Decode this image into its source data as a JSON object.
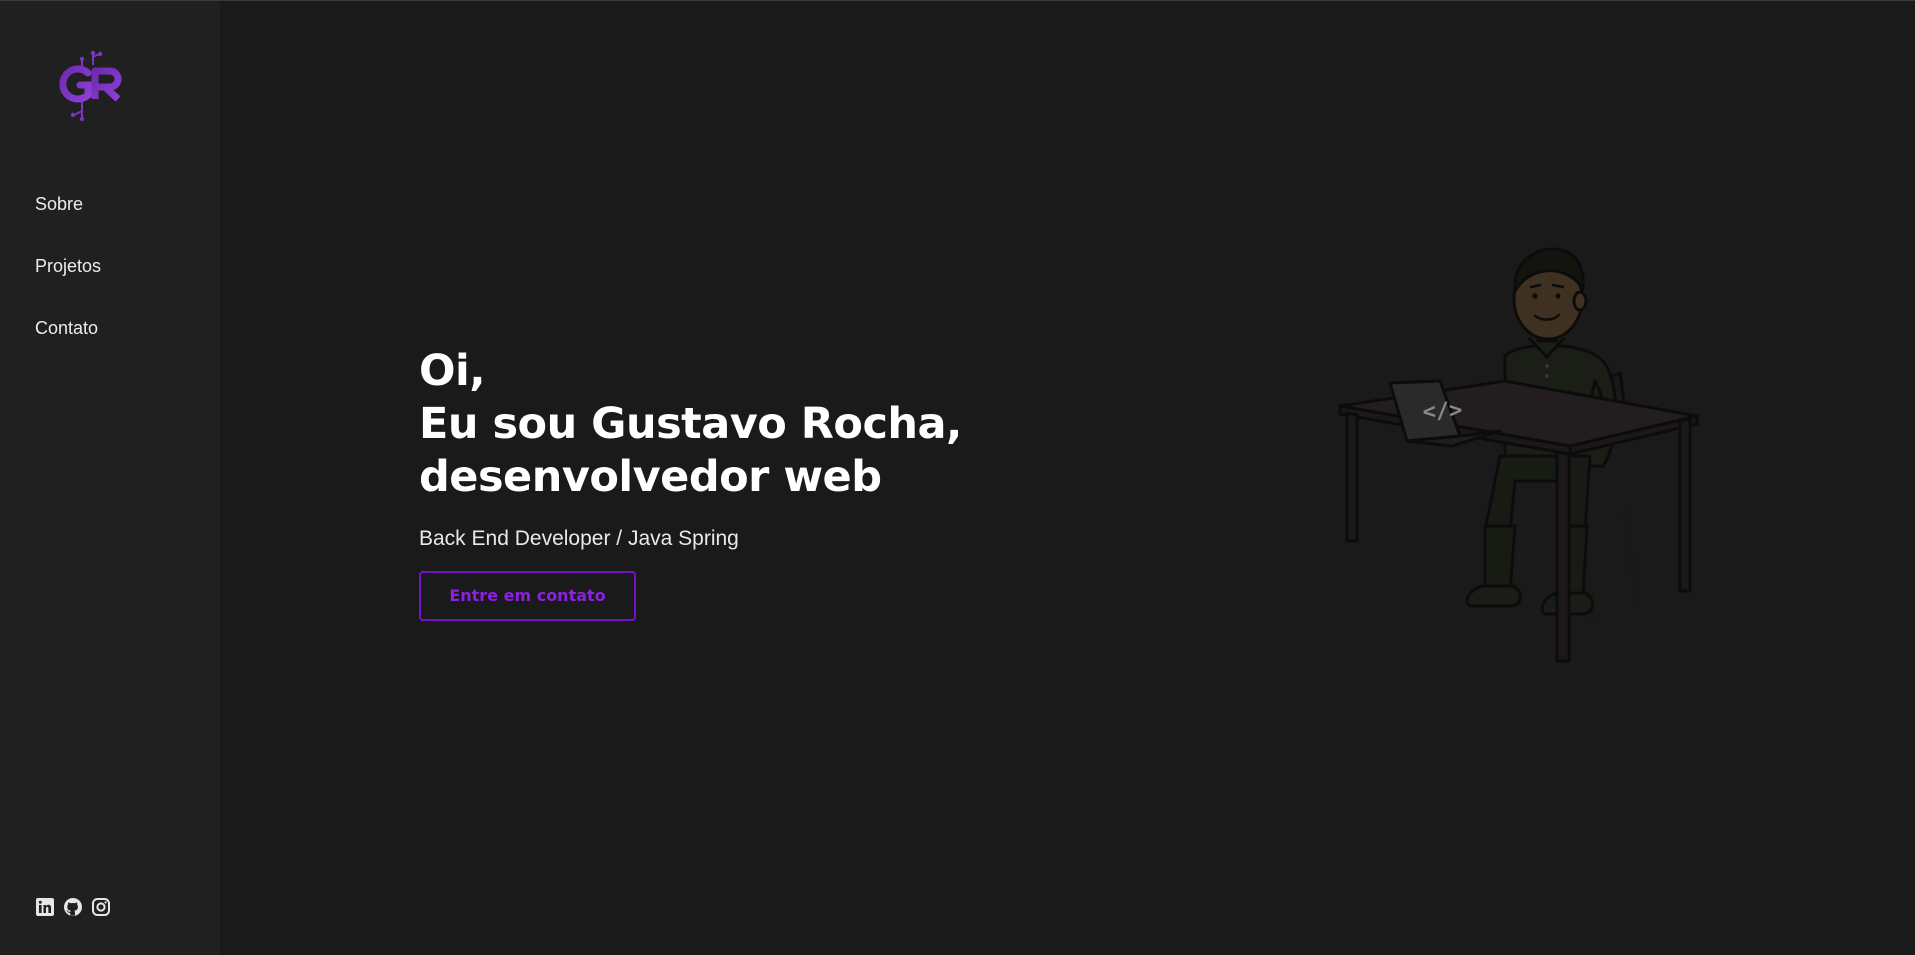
{
  "brand": {
    "logo_text": "GR",
    "logo_icon": "gr-logo-icon",
    "accent_color": "#7a0fc9"
  },
  "sidebar": {
    "nav_items": [
      {
        "label": "Sobre"
      },
      {
        "label": "Projetos"
      },
      {
        "label": "Contato"
      }
    ],
    "socials": [
      {
        "icon": "linkedin-icon"
      },
      {
        "icon": "github-icon"
      },
      {
        "icon": "instagram-icon"
      }
    ]
  },
  "hero": {
    "greeting": "Oi,",
    "intro_line": "Eu sou Gustavo Rocha,",
    "role_line": "desenvolvedor web",
    "subtitle": "Back End Developer / Java Spring",
    "cta_label": "Entre em contato"
  },
  "illustration": {
    "icon": "developer-at-desk-illustration",
    "laptop_code": "</>"
  },
  "colors": {
    "background": "#1a1a1a",
    "sidebar": "#202020",
    "cta_text": "#8f1ee6"
  }
}
